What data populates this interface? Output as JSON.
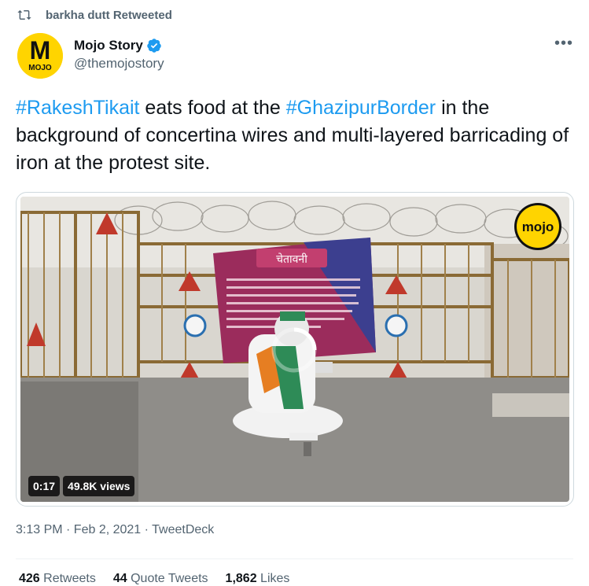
{
  "retweet": {
    "by": "barkha dutt Retweeted"
  },
  "author": {
    "name": "Mojo Story",
    "handle": "@themojostory",
    "avatar_text": "MOJO"
  },
  "tweet": {
    "hashtag1": "#RakeshTikait",
    "text1": " eats food at the ",
    "hashtag2": "#GhazipurBorder",
    "text2": " in the background of concertina wires and multi-layered barricading of iron at the protest site."
  },
  "media": {
    "logo": "mojo",
    "sign_title": "चेतावनी",
    "sign_text": "आम जनता को सूचित किया जाता है कि यहाँ धारा 144 CrPC लागू है। आप सभी से अनुरोध है कि इस क्षेत्र में किसी भी तरह एकत्रित होना या प्रदर्शन करना वर्जित है।",
    "duration": "0:17",
    "views": "49.8K views"
  },
  "meta": {
    "time": "3:13 PM · Feb 2, 2021 · TweetDeck"
  },
  "stats": {
    "retweets_count": "426",
    "retweets_label": "Retweets",
    "quotes_count": "44",
    "quotes_label": "Quote Tweets",
    "likes_count": "1,862",
    "likes_label": "Likes"
  },
  "colors": {
    "link": "#1d9bf0",
    "secondary": "#536471",
    "verified": "#1d9bf0",
    "brand": "#ffd400"
  }
}
